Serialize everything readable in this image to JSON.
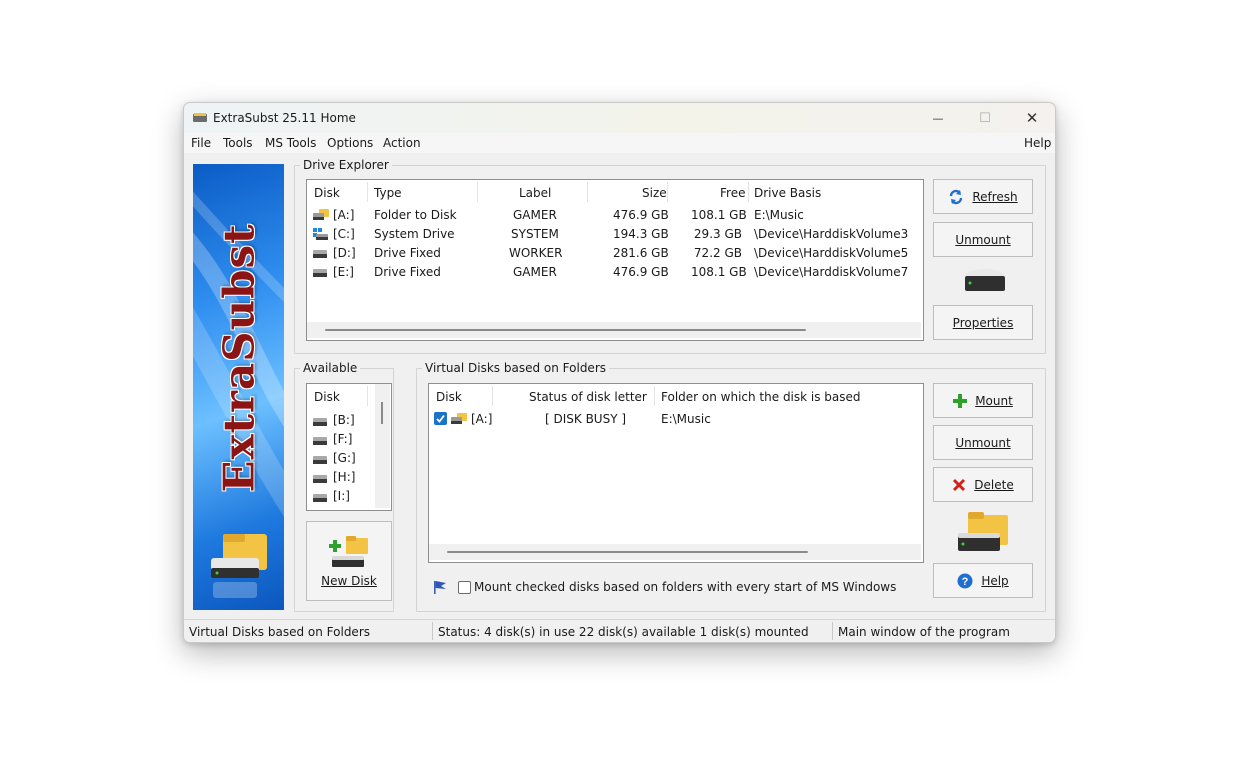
{
  "window": {
    "title": "ExtraSubst 25.11 Home",
    "controls": {
      "minimize": "—",
      "maximize": "☐",
      "close": "✕"
    }
  },
  "menu": {
    "items": [
      "File",
      "Tools",
      "MS Tools",
      "Options",
      "Action"
    ],
    "help": "Help"
  },
  "banner": {
    "text": "ExtraSubst"
  },
  "drive_explorer": {
    "label": "Drive Explorer",
    "columns": [
      "Disk",
      "Type",
      "Label",
      "Size",
      "Free",
      "Drive Basis"
    ],
    "rows": [
      {
        "disk": "[A:]",
        "type": "Folder to Disk",
        "label": "GAMER",
        "size": "476.9 GB",
        "free": "108.1 GB",
        "basis": "E:\\Music",
        "icon": "folder-drive-icon"
      },
      {
        "disk": "[C:]",
        "type": "System Drive",
        "label": "SYSTEM",
        "size": "194.3 GB",
        "free": "29.3 GB",
        "basis": "\\Device\\HarddiskVolume3",
        "icon": "windows-drive-icon"
      },
      {
        "disk": "[D:]",
        "type": "Drive Fixed",
        "label": "WORKER",
        "size": "281.6 GB",
        "free": "72.2 GB",
        "basis": "\\Device\\HarddiskVolume5",
        "icon": "hard-drive-icon"
      },
      {
        "disk": "[E:]",
        "type": "Drive Fixed",
        "label": "GAMER",
        "size": "476.9 GB",
        "free": "108.1 GB",
        "basis": "\\Device\\HarddiskVolume7",
        "icon": "hard-drive-icon"
      }
    ]
  },
  "buttons": {
    "refresh": "Refresh",
    "unmount_top": "Unmount",
    "properties": "Properties",
    "mount": "Mount",
    "unmount_bottom": "Unmount",
    "delete": "Delete",
    "help": "Help",
    "new_disk": "New Disk"
  },
  "available": {
    "label": "Available",
    "column": "Disk",
    "items": [
      "[B:]",
      "[F:]",
      "[G:]",
      "[H:]",
      "[I:]"
    ]
  },
  "virtual_disks": {
    "label": "Virtual Disks based on Folders",
    "columns": [
      "Disk",
      "Status of disk letter",
      "Folder on which the disk is based"
    ],
    "rows": [
      {
        "checked": true,
        "disk": "[A:]",
        "status": "[ DISK BUSY ]",
        "folder": "E:\\Music"
      }
    ],
    "autostart_label": "Mount checked disks based on folders with every start of MS Windows",
    "autostart_checked": false
  },
  "statusbar": {
    "left": "Virtual Disks based on Folders",
    "middle": "Status: 4 disk(s) in use   22 disk(s) available   1 disk(s) mounted",
    "right": "Main window of the program"
  },
  "colors": {
    "accent_blue": "#1e6fd0",
    "check_blue": "#1a73c7",
    "delete_red": "#d0211c",
    "mount_green": "#2ea02e",
    "folder_yellow": "#f3c443"
  }
}
